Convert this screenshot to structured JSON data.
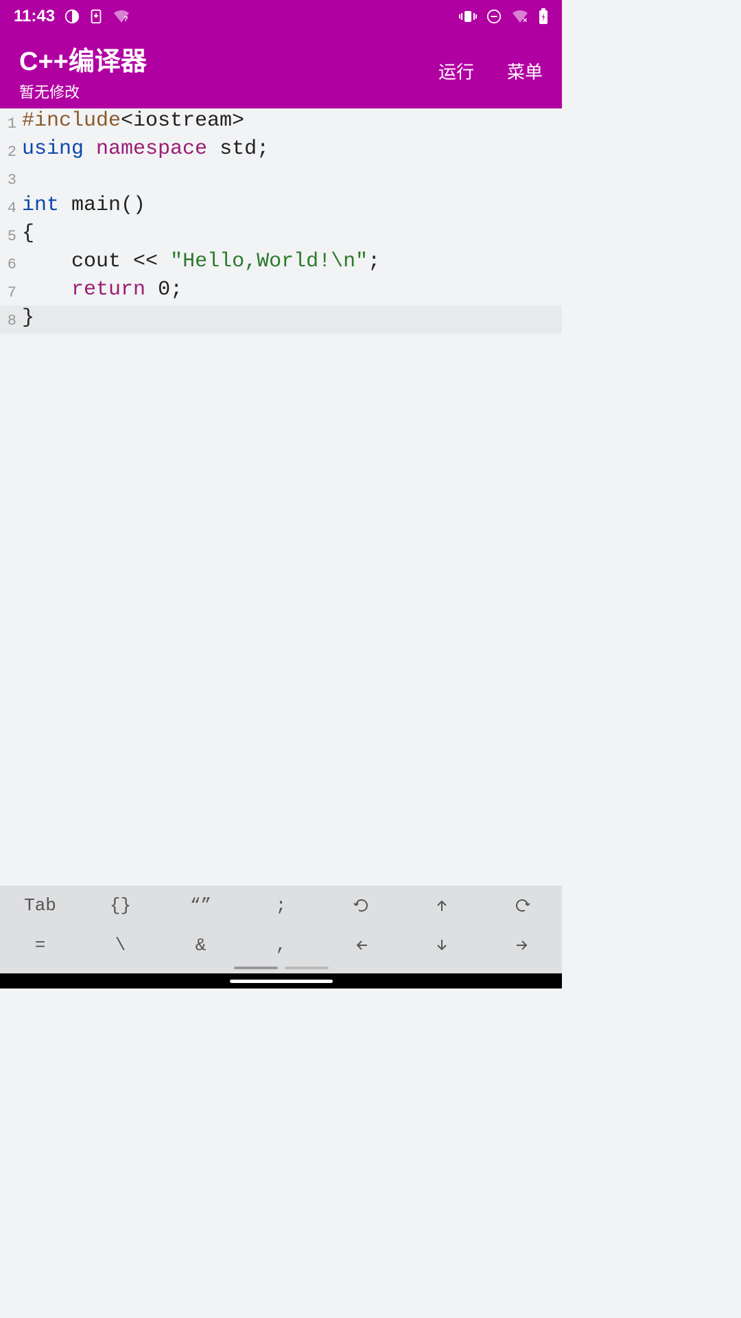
{
  "status": {
    "time": "11:43"
  },
  "header": {
    "title": "C++编译器",
    "subtitle": "暂无修改",
    "run_label": "运行",
    "menu_label": "菜单"
  },
  "code": {
    "lines": [
      {
        "n": "1",
        "tokens": [
          {
            "cls": "tok-preproc",
            "t": "#include"
          },
          {
            "cls": "tok-angle",
            "t": "<iostream>"
          }
        ]
      },
      {
        "n": "2",
        "tokens": [
          {
            "cls": "tok-keyword",
            "t": "using"
          },
          {
            "cls": "",
            "t": " "
          },
          {
            "cls": "tok-namespace",
            "t": "namespace"
          },
          {
            "cls": "",
            "t": " "
          },
          {
            "cls": "tok-ident",
            "t": "std"
          },
          {
            "cls": "tok-punct",
            "t": ";"
          }
        ]
      },
      {
        "n": "3",
        "tokens": []
      },
      {
        "n": "4",
        "tokens": [
          {
            "cls": "tok-type",
            "t": "int"
          },
          {
            "cls": "",
            "t": " "
          },
          {
            "cls": "tok-ident",
            "t": "main()"
          }
        ]
      },
      {
        "n": "5",
        "tokens": [
          {
            "cls": "tok-punct",
            "t": "{"
          }
        ]
      },
      {
        "n": "6",
        "tokens": [
          {
            "cls": "",
            "t": "    "
          },
          {
            "cls": "tok-ident",
            "t": "cout"
          },
          {
            "cls": "",
            "t": " "
          },
          {
            "cls": "tok-punct",
            "t": "<<"
          },
          {
            "cls": "",
            "t": " "
          },
          {
            "cls": "tok-string",
            "t": "\"Hello,World!\\n\""
          },
          {
            "cls": "tok-punct",
            "t": ";"
          }
        ]
      },
      {
        "n": "7",
        "tokens": [
          {
            "cls": "",
            "t": "    "
          },
          {
            "cls": "tok-return",
            "t": "return"
          },
          {
            "cls": "",
            "t": " "
          },
          {
            "cls": "tok-number",
            "t": "0"
          },
          {
            "cls": "tok-punct",
            "t": ";"
          }
        ]
      },
      {
        "n": "8",
        "highlighted": true,
        "tokens": [
          {
            "cls": "tok-punct",
            "t": "}"
          }
        ]
      }
    ]
  },
  "keyboard": {
    "row1": [
      {
        "label": "Tab",
        "name": "key-tab"
      },
      {
        "label": "{}",
        "name": "key-braces"
      },
      {
        "label": "“”",
        "name": "key-quotes"
      },
      {
        "label": ";",
        "name": "key-semicolon"
      },
      {
        "label": "↺",
        "name": "key-undo",
        "svg": "undo"
      },
      {
        "label": "⇧",
        "name": "key-up",
        "svg": "arrow-up"
      },
      {
        "label": "↻",
        "name": "key-redo",
        "svg": "redo"
      }
    ],
    "row2": [
      {
        "label": "=",
        "name": "key-equals"
      },
      {
        "label": "\\",
        "name": "key-backslash"
      },
      {
        "label": "&",
        "name": "key-ampersand"
      },
      {
        "label": ",",
        "name": "key-comma"
      },
      {
        "label": "⇦",
        "name": "key-left",
        "svg": "arrow-left"
      },
      {
        "label": "⇩",
        "name": "key-down",
        "svg": "arrow-down"
      },
      {
        "label": "⇨",
        "name": "key-right",
        "svg": "arrow-right"
      }
    ]
  }
}
